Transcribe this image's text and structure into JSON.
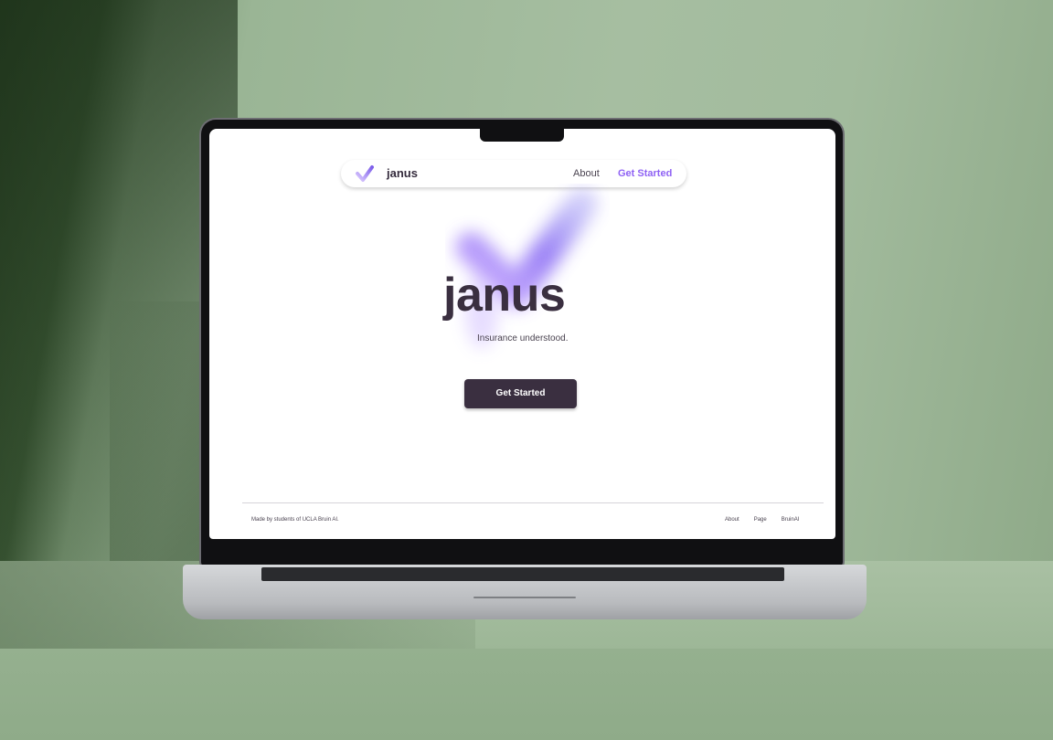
{
  "nav": {
    "brand": "janus",
    "about": "About",
    "get_started": "Get Started"
  },
  "hero": {
    "title": "janus",
    "subtitle": "Insurance understood.",
    "cta": "Get Started"
  },
  "footer": {
    "credit": "Made by students of UCLA Bruin AI.",
    "links": [
      "About",
      "Page",
      "BruinAI"
    ]
  },
  "colors": {
    "accent": "#8f62f4",
    "dark": "#3a2f40",
    "wall_green": "#9ab595"
  },
  "icons": {
    "logo": "checkmark-gradient-icon"
  }
}
